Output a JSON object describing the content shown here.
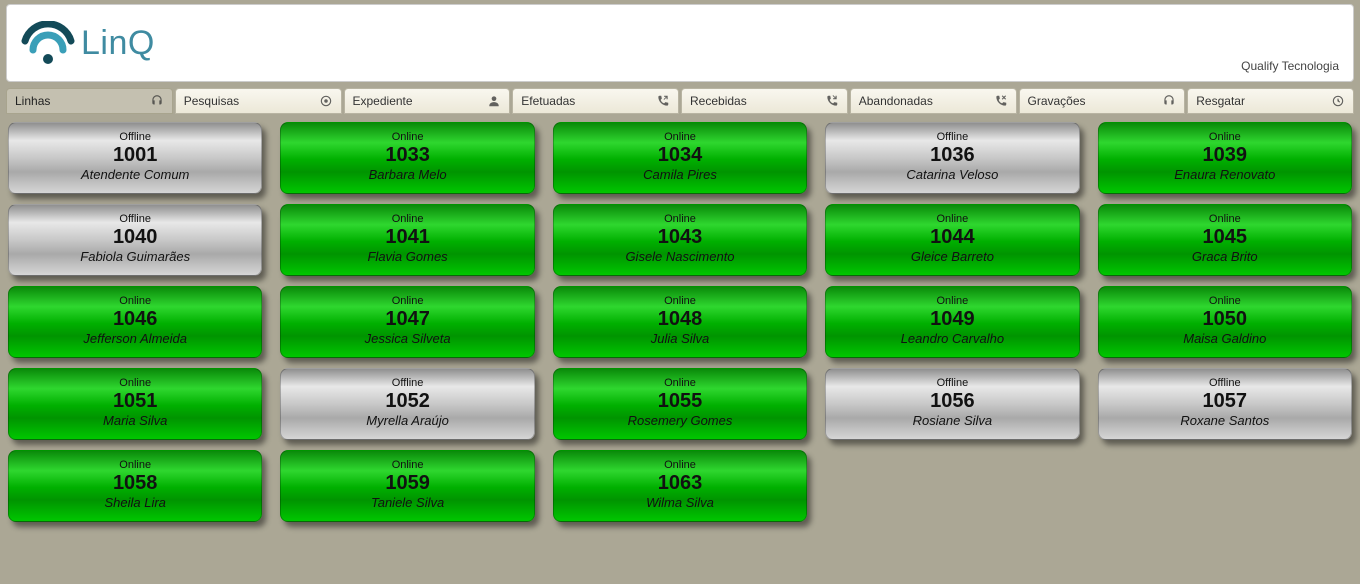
{
  "header": {
    "brand": "LinQ",
    "company": "Qualify Tecnologia"
  },
  "tabs": [
    {
      "label": "Linhas",
      "icon": "headset"
    },
    {
      "label": "Pesquisas",
      "icon": "target"
    },
    {
      "label": "Expediente",
      "icon": "person"
    },
    {
      "label": "Efetuadas",
      "icon": "phone-out"
    },
    {
      "label": "Recebidas",
      "icon": "phone-in"
    },
    {
      "label": "Abandonadas",
      "icon": "phone-miss"
    },
    {
      "label": "Gravações",
      "icon": "headset"
    },
    {
      "label": "Resgatar",
      "icon": "clock"
    }
  ],
  "active_tab_index": 0,
  "status_labels": {
    "online": "Online",
    "offline": "Offline"
  },
  "cards": [
    {
      "status": "offline",
      "ext": "1001",
      "name": "Atendente Comum"
    },
    {
      "status": "online",
      "ext": "1033",
      "name": "Barbara Melo"
    },
    {
      "status": "online",
      "ext": "1034",
      "name": "Camila Pires"
    },
    {
      "status": "offline",
      "ext": "1036",
      "name": "Catarina Veloso"
    },
    {
      "status": "online",
      "ext": "1039",
      "name": "Enaura Renovato"
    },
    {
      "status": "offline",
      "ext": "1040",
      "name": "Fabiola Guimarães"
    },
    {
      "status": "online",
      "ext": "1041",
      "name": "Flavia Gomes"
    },
    {
      "status": "online",
      "ext": "1043",
      "name": "Gisele Nascimento"
    },
    {
      "status": "online",
      "ext": "1044",
      "name": "Gleice Barreto"
    },
    {
      "status": "online",
      "ext": "1045",
      "name": "Graca Brito"
    },
    {
      "status": "online",
      "ext": "1046",
      "name": "Jefferson Almeida"
    },
    {
      "status": "online",
      "ext": "1047",
      "name": "Jessica Silveta"
    },
    {
      "status": "online",
      "ext": "1048",
      "name": "Julia Silva"
    },
    {
      "status": "online",
      "ext": "1049",
      "name": "Leandro Carvalho"
    },
    {
      "status": "online",
      "ext": "1050",
      "name": "Maisa Galdino"
    },
    {
      "status": "online",
      "ext": "1051",
      "name": "Maria Silva"
    },
    {
      "status": "offline",
      "ext": "1052",
      "name": "Myrella Araújo"
    },
    {
      "status": "online",
      "ext": "1055",
      "name": "Rosemery Gomes"
    },
    {
      "status": "offline",
      "ext": "1056",
      "name": "Rosiane Silva"
    },
    {
      "status": "offline",
      "ext": "1057",
      "name": "Roxane Santos"
    },
    {
      "status": "online",
      "ext": "1058",
      "name": "Sheila Lira"
    },
    {
      "status": "online",
      "ext": "1059",
      "name": "Taniele Silva"
    },
    {
      "status": "online",
      "ext": "1063",
      "name": "Wilma Silva"
    }
  ]
}
